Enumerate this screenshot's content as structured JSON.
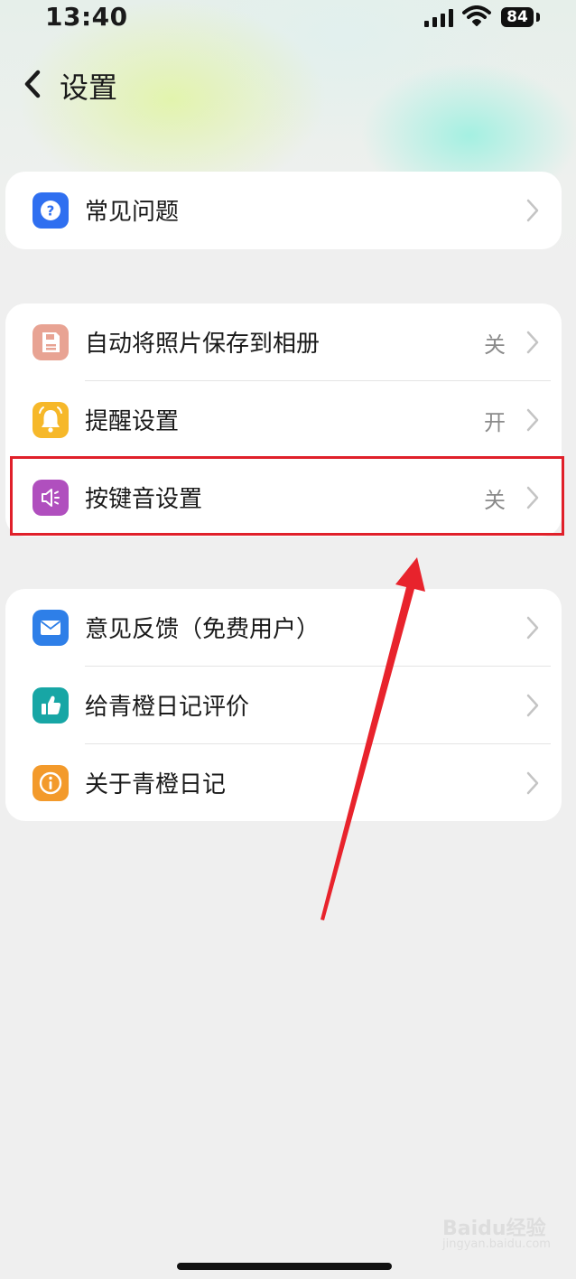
{
  "status_bar": {
    "time": "13:40",
    "battery": "84"
  },
  "nav": {
    "title": "设置"
  },
  "sections": [
    {
      "items": [
        {
          "label": "常见问题",
          "icon": "question-icon",
          "color": "#2f6ff0",
          "value": ""
        }
      ]
    },
    {
      "items": [
        {
          "label": "自动将照片保存到相册",
          "icon": "save-floppy-icon",
          "color": "#e8a393",
          "value": "关"
        },
        {
          "label": "提醒设置",
          "icon": "bell-icon",
          "color": "#f6b82a",
          "value": "开"
        },
        {
          "label": "按键音设置",
          "icon": "speaker-icon",
          "color": "#b04fbe",
          "value": "关"
        }
      ]
    },
    {
      "items": [
        {
          "label": "意见反馈（免费用户）",
          "icon": "mail-icon",
          "color": "#2e7fe8",
          "value": ""
        },
        {
          "label": "给青橙日记评价",
          "icon": "thumbs-up-icon",
          "color": "#17a6a5",
          "value": ""
        },
        {
          "label": "关于青橙日记",
          "icon": "info-icon",
          "color": "#f39a2b",
          "value": ""
        }
      ]
    }
  ],
  "watermark": {
    "brand": "Baidu经验",
    "sub": "jingyan.baidu.com"
  },
  "colors": {
    "highlight": "#e0202a",
    "arrow": "#e8232c"
  }
}
